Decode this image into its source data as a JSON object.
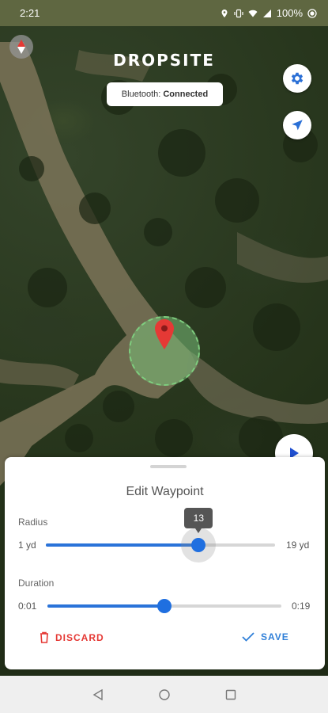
{
  "status_bar": {
    "time": "2:21",
    "battery": "100%"
  },
  "app": {
    "logo": "DROPSITE",
    "bluetooth_label": "Bluetooth:",
    "bluetooth_status": "Connected"
  },
  "icons": {
    "compass": "compass-icon",
    "settings": "gear-icon",
    "locate": "navigation-arrow-icon",
    "play": "play-icon",
    "pin": "map-pin-icon",
    "discard": "trash-icon",
    "save": "check-icon",
    "nav_back": "triangle-back-icon",
    "nav_home": "circle-home-icon",
    "nav_recents": "square-recents-icon"
  },
  "colors": {
    "accent": "#1f6fe0",
    "discard": "#e53935",
    "waypoint_fill": "#78be78",
    "pin": "#e53935"
  },
  "sheet": {
    "title": "Edit Waypoint",
    "radius": {
      "label": "Radius",
      "min_label": "1 yd",
      "max_label": "19 yd",
      "value": "13",
      "min": 1,
      "max": 19,
      "current": 13
    },
    "duration": {
      "label": "Duration",
      "min_label": "0:01",
      "max_label": "0:19",
      "min": 1,
      "max": 19,
      "current": 10
    },
    "discard_label": "DISCARD",
    "save_label": "SAVE"
  }
}
